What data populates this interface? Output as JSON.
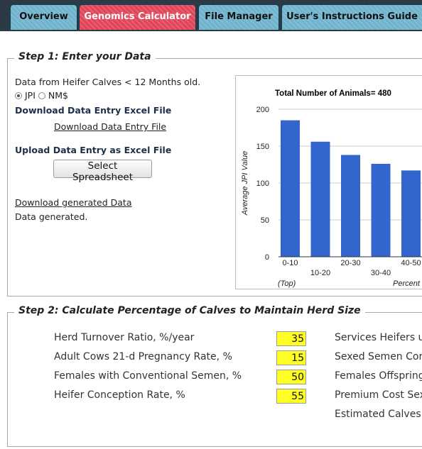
{
  "tabs": [
    {
      "label": "Overview"
    },
    {
      "label": "Genomics Calculator"
    },
    {
      "label": "File Manager"
    },
    {
      "label": "User's Instructions Guide"
    }
  ],
  "step1": {
    "legend": "Step 1: Enter your Data",
    "data_source": "Data from Heifer Calves < 12 Months old.",
    "radio_options": [
      {
        "label": "JPI",
        "selected": true
      },
      {
        "label": "NM$",
        "selected": false
      }
    ],
    "download_heading": "Download Data Entry Excel File",
    "download_link": "Download Data Entry File",
    "upload_heading": "Upload Data Entry as Excel File",
    "select_button": "Select Spreadsheet",
    "generated_link": "Download generated Data",
    "status": "Data generated."
  },
  "chart_data": {
    "type": "bar",
    "title": "Total Number of Animals= 480",
    "ylabel": "Average JPI Value",
    "xlabel": "Percent",
    "xlabel_left": "(Top)",
    "categories": [
      "0-10",
      "10-20",
      "20-30",
      "30-40",
      "40-50"
    ],
    "values": [
      185,
      156,
      138,
      126,
      117
    ],
    "ylim": [
      0,
      200
    ],
    "yticks": [
      0,
      50,
      100,
      150,
      200
    ],
    "bar_color": "#3366cc",
    "grid": true
  },
  "step2": {
    "legend": "Step 2: Calculate Percentage of Calves to Maintain Herd Size",
    "inputs": [
      {
        "label": "Herd Turnover Ratio, %/year",
        "value": "35"
      },
      {
        "label": "Adult Cows 21-d Pregnancy Rate, %",
        "value": "15"
      },
      {
        "label": "Females with Conventional Semen, %",
        "value": "50"
      },
      {
        "label": "Heifer Conception Rate, %",
        "value": "55"
      }
    ],
    "right_labels": [
      {
        "label": "Services Heifers u"
      },
      {
        "label": "Sexed Semen Con"
      },
      {
        "label": "Females Offspring"
      },
      {
        "label": "Premium Cost Sex"
      },
      {
        "label": "Estimated Calves"
      }
    ]
  }
}
